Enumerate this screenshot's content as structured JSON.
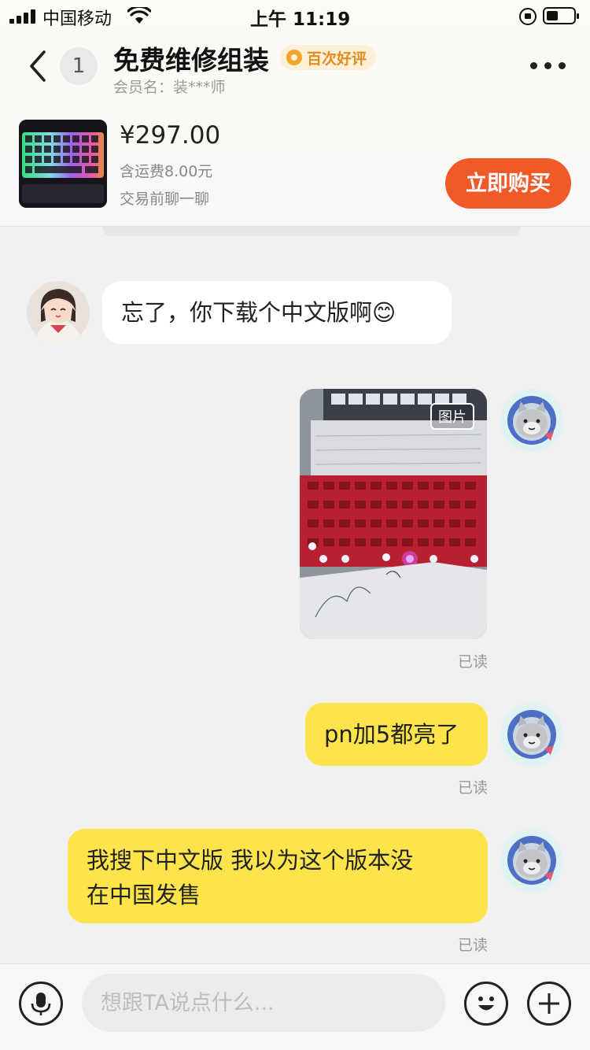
{
  "status_bar": {
    "carrier": "中国移动",
    "time": "上午 11:19"
  },
  "header": {
    "unread_count": "1",
    "title": "免费维修组装",
    "badge": "百次好评",
    "member_label": "会员名：装***师"
  },
  "product": {
    "price": "¥297.00",
    "shipping": "含运费8.00元",
    "chat_tip": "交易前聊一聊",
    "buy_label": "立即购买"
  },
  "messages": [
    {
      "side": "in",
      "text": "忘了，你下载个中文版啊😊"
    },
    {
      "side": "out",
      "type": "image",
      "tag": "图片",
      "status": "已读"
    },
    {
      "side": "out",
      "text": "pn加5都亮了",
      "status": "已读"
    },
    {
      "side": "out",
      "text_line1": "我搜下中文版 我以为这个版本没",
      "text_line2": "在中国发售",
      "status": "已读"
    }
  ],
  "input": {
    "placeholder": "想跟TA说点什么..."
  },
  "colors": {
    "accent": "#f05a28",
    "out_bubble": "#fde44b",
    "badge_text": "#e38b1c"
  },
  "icons": [
    "back-arrow-icon",
    "more-dots-icon",
    "voice-icon",
    "emoji-icon",
    "plus-icon"
  ]
}
